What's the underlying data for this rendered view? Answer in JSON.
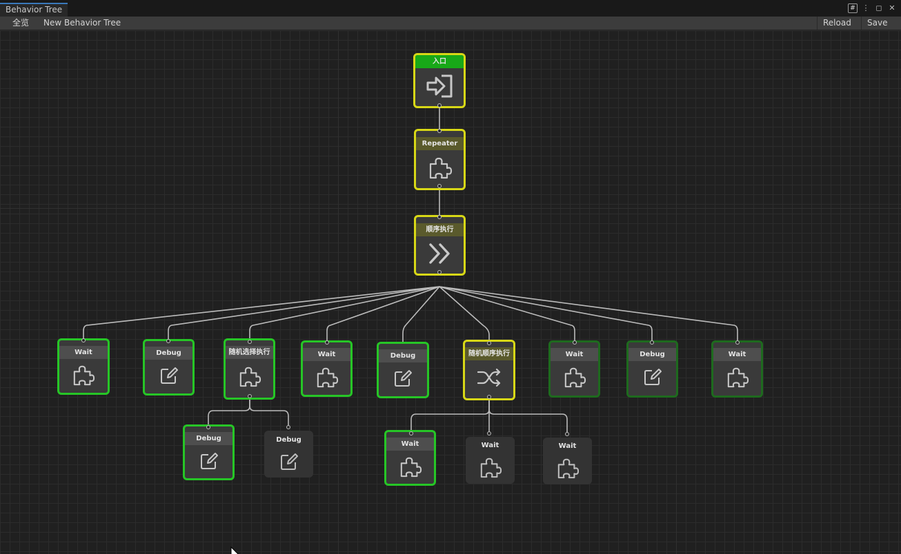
{
  "window": {
    "tab_title": "Behavior Tree"
  },
  "toolbar": {
    "overview": "全览",
    "tree_name": "New Behavior Tree",
    "reload": "Reload",
    "save": "Save"
  },
  "nodes": {
    "entry": {
      "title": "入口",
      "icon": "enter-icon"
    },
    "repeater": {
      "title": "Repeater",
      "icon": "puzzle-icon"
    },
    "sequence": {
      "title": "顺序执行",
      "icon": "double-chevron-icon"
    },
    "wait1": {
      "title": "Wait",
      "icon": "puzzle-icon"
    },
    "debug1": {
      "title": "Debug",
      "icon": "edit-icon"
    },
    "random_select": {
      "title": "随机选择执行",
      "icon": "puzzle-icon"
    },
    "wait2": {
      "title": "Wait",
      "icon": "puzzle-icon"
    },
    "debug2": {
      "title": "Debug",
      "icon": "edit-icon"
    },
    "random_sequence": {
      "title": "随机顺序执行",
      "icon": "shuffle-icon"
    },
    "wait3": {
      "title": "Wait",
      "icon": "puzzle-icon"
    },
    "debug3": {
      "title": "Debug",
      "icon": "edit-icon"
    },
    "wait4": {
      "title": "Wait",
      "icon": "puzzle-icon"
    },
    "rs_debug1": {
      "title": "Debug",
      "icon": "edit-icon"
    },
    "rs_debug2": {
      "title": "Debug",
      "icon": "edit-icon"
    },
    "rq_wait1": {
      "title": "Wait",
      "icon": "puzzle-icon"
    },
    "rq_wait2": {
      "title": "Wait",
      "icon": "puzzle-icon"
    },
    "rq_wait3": {
      "title": "Wait",
      "icon": "puzzle-icon"
    }
  },
  "colors": {
    "selected_border": "#d8d816",
    "running_border": "#26c626",
    "success_border": "#1e6a1e",
    "idle_border": "#2c2c2c",
    "entry_header": "#18a818",
    "edge": "#bcbcbc"
  }
}
